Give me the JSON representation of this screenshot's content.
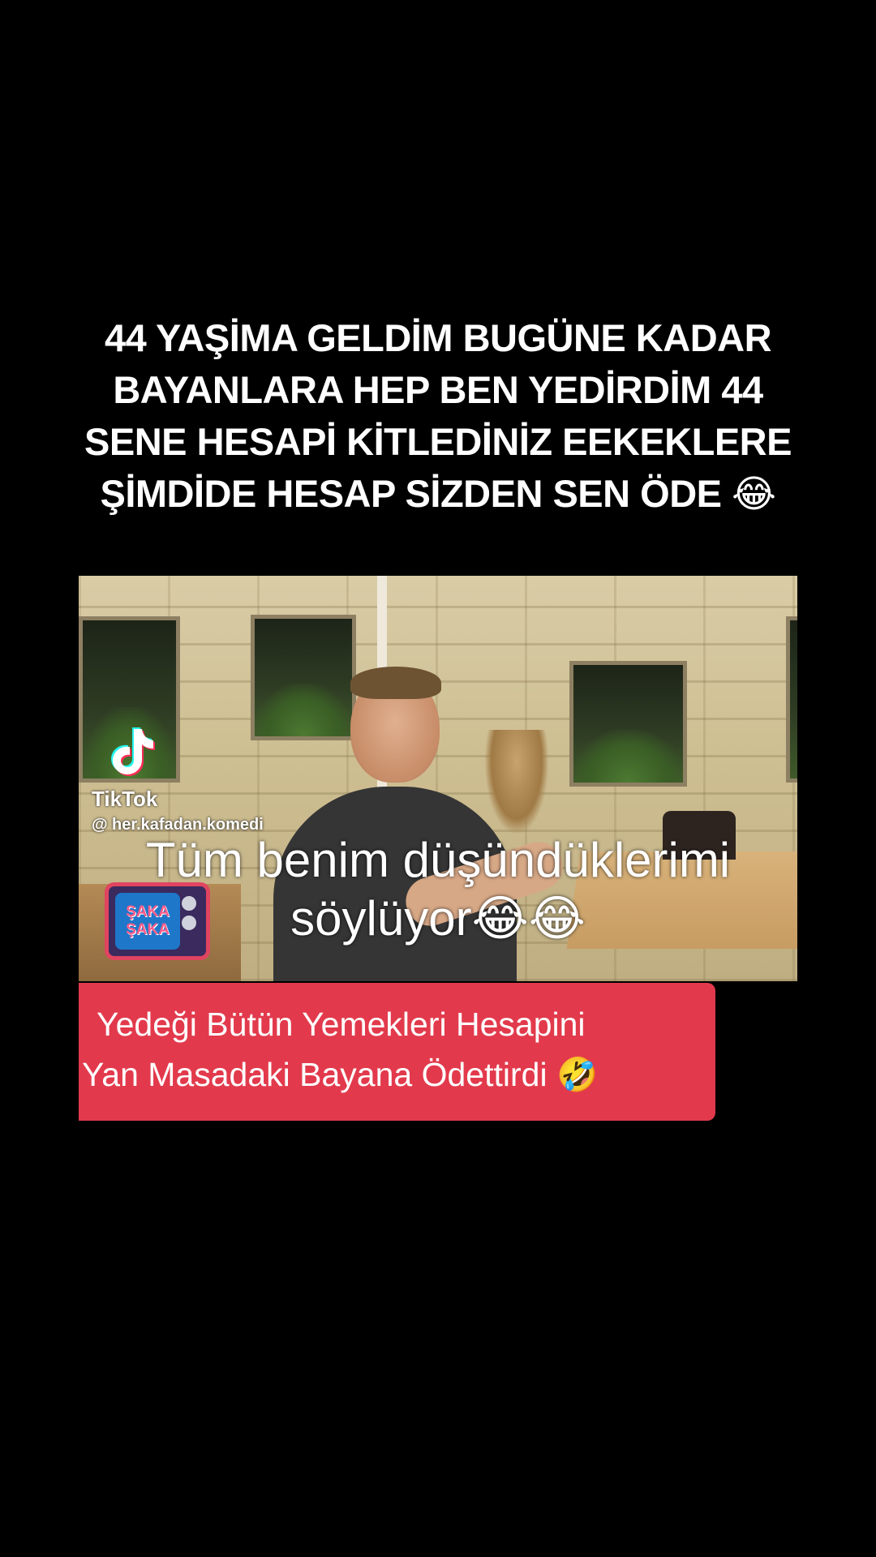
{
  "top_caption": {
    "line1": "44 YAŞİMA GELDİM BUGÜNE KADAR",
    "line2": "BAYANLARA HEP BEN YEDİRDİM 44",
    "line3": "SENE HESAPİ KİTLEDİNİZ EEKEKLERE",
    "line4": "ŞİMDİDE HESAP SİZDEN SEN ÖDE 😂"
  },
  "video": {
    "watermark_brand": "TikTok",
    "watermark_handle": "@ her.kafadan.komedi",
    "channel_logo_line1": "ŞAKA",
    "channel_logo_line2": "ŞAKA"
  },
  "overlay_caption": {
    "line1": "Tüm benim düşündüklerimi",
    "line2": "söylüyor😂😂"
  },
  "red_banner": {
    "line1": "Yedeği Bütün Yemekleri Hesapini",
    "line2": "Yan Masadaki Bayana Ödettirdi 🤣"
  },
  "colors": {
    "background": "#000000",
    "banner": "#e23a4c",
    "text": "#ffffff"
  }
}
